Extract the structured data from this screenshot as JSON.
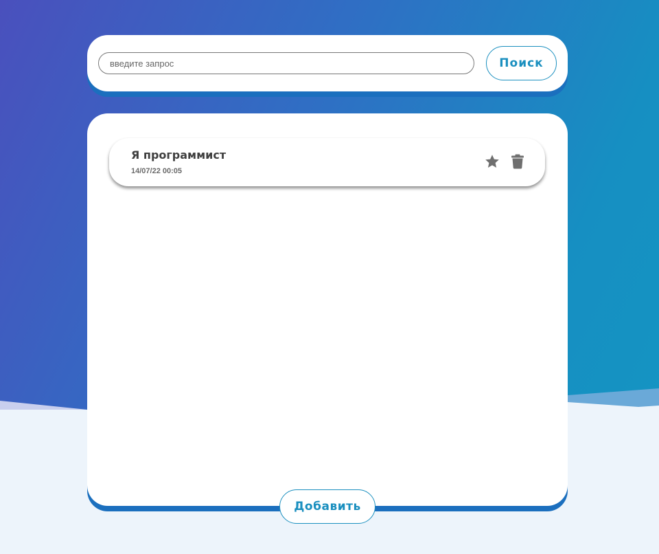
{
  "search": {
    "placeholder": "введите запрос",
    "value": "",
    "button_label": "Поиск"
  },
  "notes": [
    {
      "title": "Я программист",
      "date": "14/07/22 00:05",
      "favorite_icon": "star-icon",
      "delete_icon": "trash-icon"
    }
  ],
  "footer": {
    "add_label": "Добавить"
  },
  "colors": {
    "accent": "#1a8fbf",
    "card_shadow": "#1b6fbe",
    "background_start": "#4a50bd",
    "background_end": "#1496c3",
    "icon": "#6f6f6f"
  }
}
